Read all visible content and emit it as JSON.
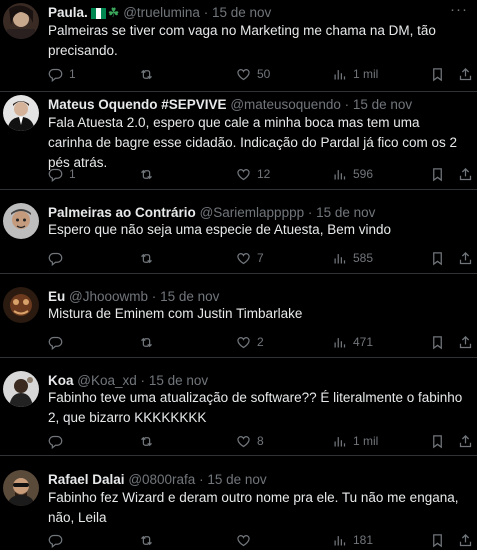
{
  "tweets": [
    {
      "name": "Paula.",
      "handle": "@truelumina",
      "separator": "·",
      "date": "15 de nov",
      "text": "Palmeiras se tiver com vaga no Marketing me chama na DM, tão precisando.",
      "replies": "1",
      "retweets": "",
      "likes": "50",
      "views": "1 mil",
      "has_badge": true
    },
    {
      "name": "Mateus Oquendo #SEPVIVE",
      "handle": "@mateusoquendo",
      "separator": "·",
      "date": "15 de nov",
      "text": "Fala Atuesta 2.0, espero que cale a minha boca mas tem uma carinha de bagre esse cidadão. Indicação do Pardal já fico com os 2 pés atrás.",
      "replies": "1",
      "retweets": "",
      "likes": "12",
      "views": "596"
    },
    {
      "name": "Palmeiras ao Contrário",
      "handle": "@Sariemlappppp",
      "separator": "·",
      "date": "15 de nov",
      "text": "Espero que não seja uma especie de Atuesta, Bem vindo",
      "replies": "",
      "retweets": "",
      "likes": "7",
      "views": "585"
    },
    {
      "name": "Eu",
      "handle": "@Jhooowmb",
      "separator": "·",
      "date": "15 de nov",
      "text": "Mistura de Eminem com Justin Timbarlake",
      "replies": "",
      "retweets": "",
      "likes": "2",
      "views": "471"
    },
    {
      "name": "Koa",
      "handle": "@Koa_xd",
      "separator": "·",
      "date": "15 de nov",
      "text": "Fabinho teve uma atualização de software?? É literalmente o fabinho 2, que bizarro KKKKKKKK",
      "replies": "",
      "retweets": "",
      "likes": "8",
      "views": "1 mil"
    },
    {
      "name": "Rafael Dalai",
      "handle": "@0800rafa",
      "separator": "·",
      "date": "15 de nov",
      "text": "Fabinho fez Wizard e deram outro nome pra ele. Tu não me engana, não, Leila",
      "replies": "",
      "retweets": "",
      "likes": "",
      "views": "181"
    }
  ],
  "badge_emoji": "☘",
  "more_glyph": "···",
  "colors": {
    "background": "#000000",
    "text_primary": "#e7e9ea",
    "text_secondary": "#71767b",
    "divider": "#2f3336",
    "shamrock": "#3ba55c",
    "flag_green": "#008751"
  },
  "icons": [
    "reply-icon",
    "retweet-icon",
    "like-icon",
    "views-icon",
    "bookmark-icon",
    "share-icon",
    "more-icon"
  ]
}
